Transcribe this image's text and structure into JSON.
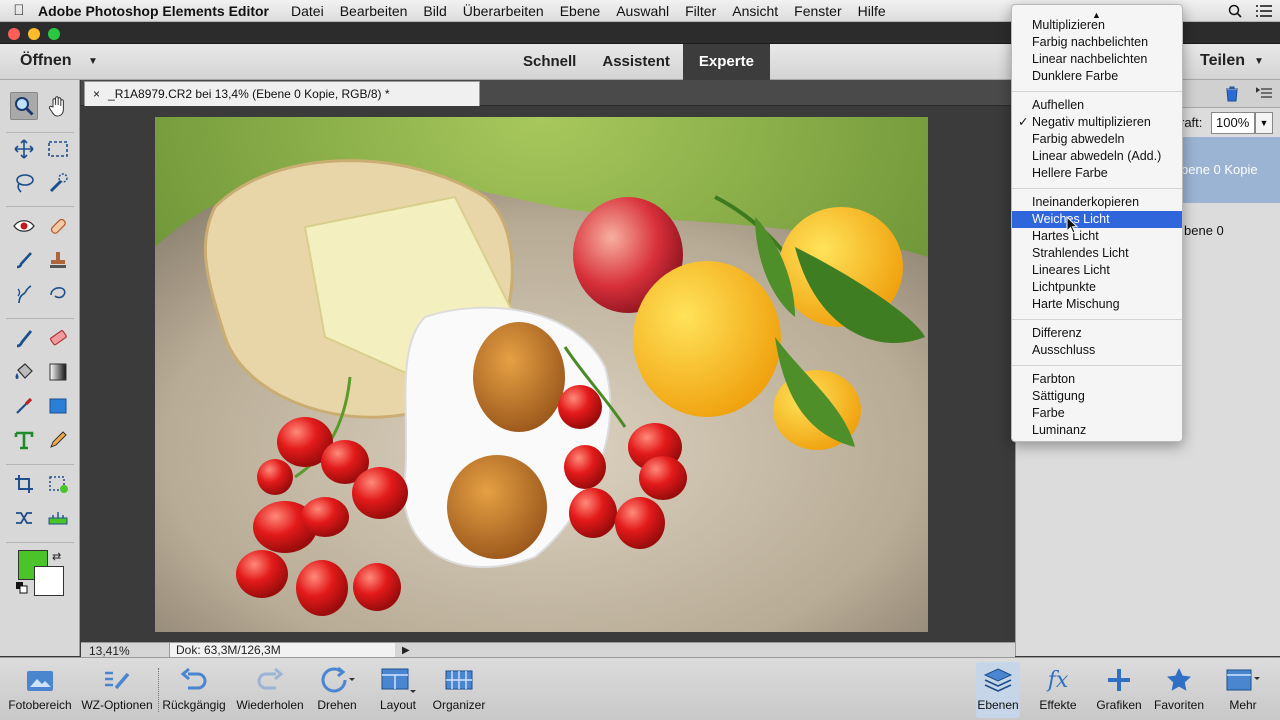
{
  "menubar": {
    "app_name": "Adobe Photoshop Elements Editor",
    "items": [
      "Datei",
      "Bearbeiten",
      "Bild",
      "Überarbeiten",
      "Ebene",
      "Auswahl",
      "Filter",
      "Ansicht",
      "Fenster",
      "Hilfe"
    ]
  },
  "modebar": {
    "open_label": "Öffnen",
    "modes": [
      "Schnell",
      "Assistent",
      "Experte"
    ],
    "active_mode": "Experte",
    "share_label": "Teilen"
  },
  "document": {
    "tab_title": "_R1A8979.CR2 bei 13,4% (Ebene 0 Kopie, RGB/8) *",
    "close_glyph": "×"
  },
  "statusbar": {
    "zoom": "13,41%",
    "doc_size": "Dok: 63,3M/126,3M"
  },
  "colors": {
    "foreground": "#4bc42a",
    "background": "#ffffff",
    "menu_highlight": "#2f66db",
    "active_mode_bg": "#3c3c3c"
  },
  "layers_panel": {
    "opacity_label": "raft:",
    "opacity_value": "100%",
    "selected_layer_name": "bene 0 Kopie",
    "layer2_name": "bene 0"
  },
  "blend_menu": {
    "groups": [
      [
        "Multiplizieren",
        "Farbig nachbelichten",
        "Linear nachbelichten",
        "Dunklere Farbe"
      ],
      [
        "Aufhellen",
        "Negativ multiplizieren",
        "Farbig abwedeln",
        "Linear abwedeln (Add.)",
        "Hellere Farbe"
      ],
      [
        "Ineinanderkopieren",
        "Weiches Licht",
        "Hartes Licht",
        "Strahlendes Licht",
        "Lineares Licht",
        "Lichtpunkte",
        "Harte Mischung"
      ],
      [
        "Differenz",
        "Ausschluss"
      ],
      [
        "Farbton",
        "Sättigung",
        "Farbe",
        "Luminanz"
      ]
    ],
    "checked": "Negativ multiplizieren",
    "highlighted": "Weiches Licht",
    "check_glyph": "✓",
    "scroll_up_glyph": "▲"
  },
  "bottombar": {
    "left": [
      "Fotobereich",
      "WZ-Optionen",
      "Rückgängig",
      "Wiederholen",
      "Drehen",
      "Layout",
      "Organizer"
    ],
    "right": [
      "Ebenen",
      "Effekte",
      "Grafiken",
      "Favoriten",
      "Mehr"
    ]
  },
  "icons": [
    "apple-icon",
    "bluetooth-icon",
    "wifi-icon",
    "search-icon",
    "list-icon",
    "zoom-tool-icon",
    "hand-tool-icon",
    "move-tool-icon",
    "marquee-tool-icon",
    "lasso-tool-icon",
    "quick-selection-icon",
    "red-eye-icon",
    "healing-brush-icon",
    "brush-icon",
    "clone-stamp-icon",
    "smart-brush-icon",
    "recompose-icon",
    "eraser-icon",
    "paint-bucket-icon",
    "gradient-icon",
    "eyedropper-icon",
    "shape-icon",
    "text-tool-icon",
    "pencil-icon",
    "crop-icon",
    "recompose-tool-icon",
    "content-aware-move-icon",
    "straighten-icon",
    "trash-icon",
    "panel-menu-icon"
  ]
}
